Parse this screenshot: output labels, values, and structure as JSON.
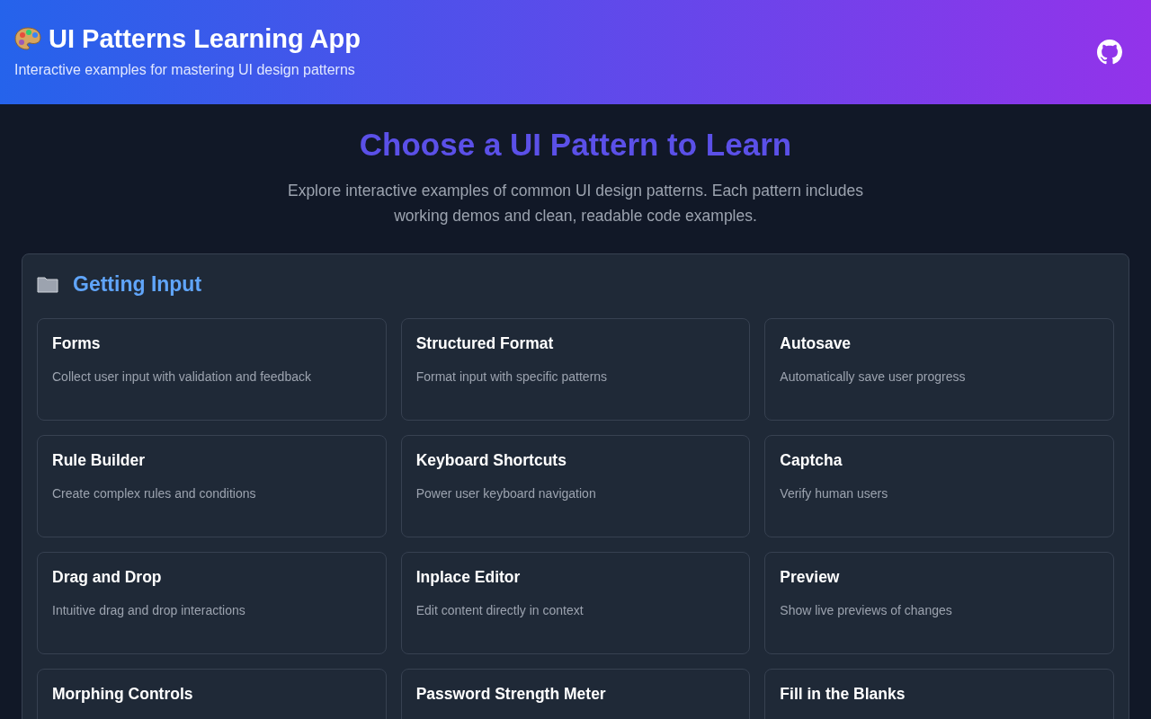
{
  "header": {
    "title": "UI Patterns Learning App",
    "subtitle": "Interactive examples for mastering UI design patterns"
  },
  "intro": {
    "heading": "Choose a UI Pattern to Learn",
    "text": "Explore interactive examples of common UI design patterns. Each pattern includes working demos and clean, readable code examples."
  },
  "sections": [
    {
      "title": "Getting Input",
      "patterns": [
        {
          "title": "Forms",
          "description": "Collect user input with validation and feedback"
        },
        {
          "title": "Structured Format",
          "description": "Format input with specific patterns"
        },
        {
          "title": "Autosave",
          "description": "Automatically save user progress"
        },
        {
          "title": "Rule Builder",
          "description": "Create complex rules and conditions"
        },
        {
          "title": "Keyboard Shortcuts",
          "description": "Power user keyboard navigation"
        },
        {
          "title": "Captcha",
          "description": "Verify human users"
        },
        {
          "title": "Drag and Drop",
          "description": "Intuitive drag and drop interactions"
        },
        {
          "title": "Inplace Editor",
          "description": "Edit content directly in context"
        },
        {
          "title": "Preview",
          "description": "Show live previews of changes"
        },
        {
          "title": "Morphing Controls"
        },
        {
          "title": "Password Strength Meter"
        },
        {
          "title": "Fill in the Blanks"
        }
      ]
    }
  ]
}
